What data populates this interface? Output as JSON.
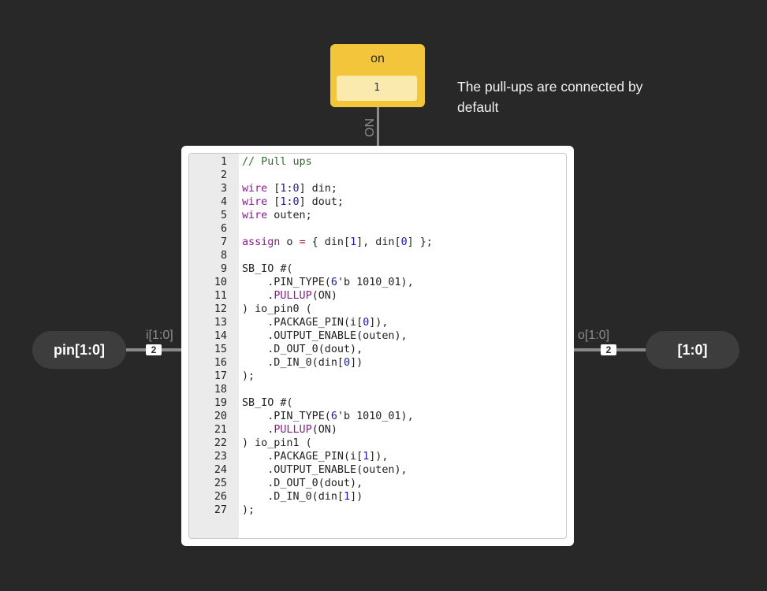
{
  "constant": {
    "label": "on",
    "value": "1",
    "wire_label": "ON",
    "color": "#f3c53b"
  },
  "note": {
    "text": "The pull-ups are connected by default"
  },
  "input_pin": {
    "label": "pin[1:0]",
    "port_label": "i[1:0]",
    "width": "2"
  },
  "output_pin": {
    "label": "[1:0]",
    "port_label": "o[1:0]",
    "width": "2"
  },
  "code": {
    "lines": [
      {
        "n": "1",
        "tokens": [
          {
            "t": "// Pull ups",
            "c": "comment"
          }
        ]
      },
      {
        "n": "2",
        "tokens": []
      },
      {
        "n": "3",
        "tokens": [
          {
            "t": "wire",
            "c": "kw"
          },
          {
            "t": " ["
          },
          {
            "t": "1",
            "c": "num"
          },
          {
            "t": ":"
          },
          {
            "t": "0",
            "c": "num"
          },
          {
            "t": "] din;"
          }
        ]
      },
      {
        "n": "4",
        "tokens": [
          {
            "t": "wire",
            "c": "kw"
          },
          {
            "t": " ["
          },
          {
            "t": "1",
            "c": "num"
          },
          {
            "t": ":"
          },
          {
            "t": "0",
            "c": "num"
          },
          {
            "t": "] dout;"
          }
        ]
      },
      {
        "n": "5",
        "tokens": [
          {
            "t": "wire",
            "c": "kw"
          },
          {
            "t": " outen;"
          }
        ]
      },
      {
        "n": "6",
        "tokens": []
      },
      {
        "n": "7",
        "tokens": [
          {
            "t": "assign",
            "c": "kw"
          },
          {
            "t": " o "
          },
          {
            "t": "=",
            "c": "op"
          },
          {
            "t": " { din["
          },
          {
            "t": "1",
            "c": "num"
          },
          {
            "t": "], din["
          },
          {
            "t": "0",
            "c": "num"
          },
          {
            "t": "] };"
          }
        ]
      },
      {
        "n": "8",
        "tokens": []
      },
      {
        "n": "9",
        "tokens": [
          {
            "t": "SB_IO #("
          }
        ]
      },
      {
        "n": "10",
        "tokens": [
          {
            "t": "    .PIN_TYPE("
          },
          {
            "t": "6",
            "c": "num"
          },
          {
            "t": "'b 1010_01),"
          }
        ]
      },
      {
        "n": "11",
        "tokens": [
          {
            "t": "    ."
          },
          {
            "t": "PULLUP",
            "c": "attr"
          },
          {
            "t": "(ON)"
          }
        ]
      },
      {
        "n": "12",
        "tokens": [
          {
            "t": ") io_pin0 ("
          }
        ]
      },
      {
        "n": "13",
        "tokens": [
          {
            "t": "    .PACKAGE_PIN(i["
          },
          {
            "t": "0",
            "c": "num"
          },
          {
            "t": "]),"
          }
        ]
      },
      {
        "n": "14",
        "tokens": [
          {
            "t": "    .OUTPUT_ENABLE(outen),"
          }
        ]
      },
      {
        "n": "15",
        "tokens": [
          {
            "t": "    .D_OUT_0(dout),"
          }
        ]
      },
      {
        "n": "16",
        "tokens": [
          {
            "t": "    .D_IN_0(din["
          },
          {
            "t": "0",
            "c": "num"
          },
          {
            "t": "])"
          }
        ]
      },
      {
        "n": "17",
        "tokens": [
          {
            "t": ");"
          }
        ]
      },
      {
        "n": "18",
        "tokens": []
      },
      {
        "n": "19",
        "tokens": [
          {
            "t": "SB_IO #("
          }
        ]
      },
      {
        "n": "20",
        "tokens": [
          {
            "t": "    .PIN_TYPE("
          },
          {
            "t": "6",
            "c": "num"
          },
          {
            "t": "'b 1010_01),"
          }
        ]
      },
      {
        "n": "21",
        "tokens": [
          {
            "t": "    ."
          },
          {
            "t": "PULLUP",
            "c": "attr"
          },
          {
            "t": "(ON)"
          }
        ]
      },
      {
        "n": "22",
        "tokens": [
          {
            "t": ") io_pin1 ("
          }
        ]
      },
      {
        "n": "23",
        "tokens": [
          {
            "t": "    .PACKAGE_PIN(i["
          },
          {
            "t": "1",
            "c": "num"
          },
          {
            "t": "]),"
          }
        ]
      },
      {
        "n": "24",
        "tokens": [
          {
            "t": "    .OUTPUT_ENABLE(outen),"
          }
        ]
      },
      {
        "n": "25",
        "tokens": [
          {
            "t": "    .D_OUT_0(dout),"
          }
        ]
      },
      {
        "n": "26",
        "tokens": [
          {
            "t": "    .D_IN_0(din["
          },
          {
            "t": "1",
            "c": "num"
          },
          {
            "t": "])"
          }
        ]
      },
      {
        "n": "27",
        "tokens": [
          {
            "t": ");"
          }
        ]
      }
    ]
  }
}
